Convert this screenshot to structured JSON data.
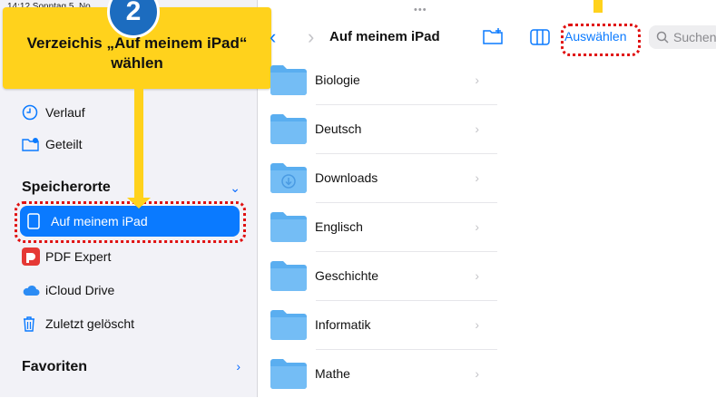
{
  "status_bar": {
    "time_date": "14:12 Sonntag 5. No"
  },
  "annotation": {
    "step_number": "2",
    "callout_text_line1": "Verzeichis „Auf meinem iPad“",
    "callout_text_line2": "wählen",
    "accent": "#ffd21c",
    "badge_color": "#1c6cbf",
    "highlight_color": "#e01010"
  },
  "sidebar": {
    "recents": [
      {
        "label": "Verlauf",
        "icon": "clock-icon"
      },
      {
        "label": "Geteilt",
        "icon": "shared-folder-icon"
      }
    ],
    "locations_title": "Speicherorte",
    "locations": [
      {
        "label": "Auf meinem iPad",
        "icon": "ipad-icon",
        "selected": true
      },
      {
        "label": "PDF Expert",
        "icon": "pdf-expert-icon"
      },
      {
        "label": "iCloud Drive",
        "icon": "icloud-icon"
      },
      {
        "label": "Zuletzt gelöscht",
        "icon": "trash-icon"
      }
    ],
    "favorites_title": "Favoriten"
  },
  "toolbar": {
    "title": "Auf meinem iPad",
    "select_label": "Auswählen",
    "search_placeholder": "Suchen",
    "accent": "#0a7aff"
  },
  "files": [
    {
      "name": "Biologie"
    },
    {
      "name": "Deutsch"
    },
    {
      "name": "Downloads",
      "download_badge": true
    },
    {
      "name": "Englisch"
    },
    {
      "name": "Geschichte"
    },
    {
      "name": "Informatik"
    },
    {
      "name": "Mathe"
    }
  ]
}
